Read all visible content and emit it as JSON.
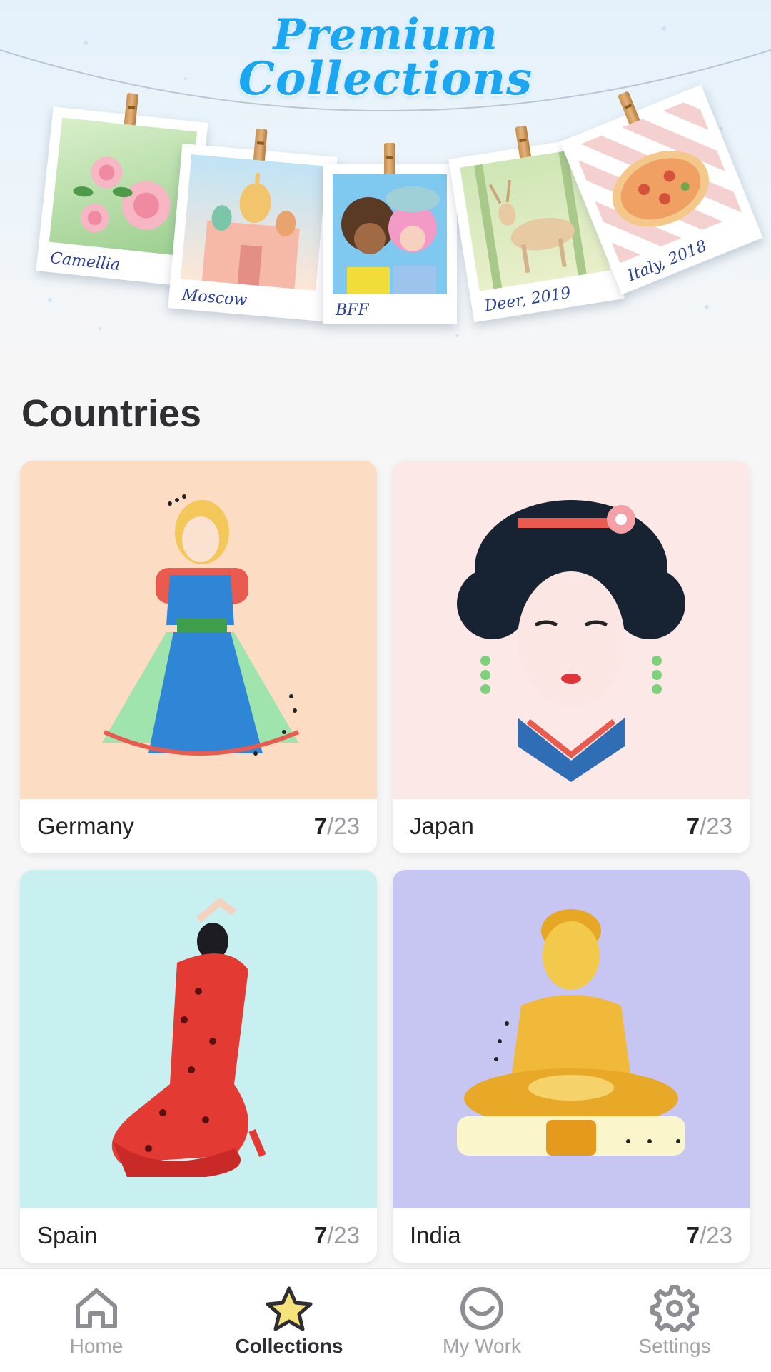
{
  "banner": {
    "title_line1": "Premium",
    "title_line2": "Collections",
    "photos": [
      {
        "caption": "Camellia"
      },
      {
        "caption": "Moscow"
      },
      {
        "caption": "BFF"
      },
      {
        "caption": "Deer, 2019"
      },
      {
        "caption": "Italy, 2018"
      }
    ]
  },
  "section": {
    "title": "Countries"
  },
  "cards": [
    {
      "name": "Germany",
      "done": "7",
      "total": "/23",
      "bg": "#fcdcc3"
    },
    {
      "name": "Japan",
      "done": "7",
      "total": "/23",
      "bg": "#fde8e8"
    },
    {
      "name": "Spain",
      "done": "7",
      "total": "/23",
      "bg": "#c9f0f1"
    },
    {
      "name": "India",
      "done": "7",
      "total": "/23",
      "bg": "#c7c5f2"
    }
  ],
  "nav": {
    "items": [
      {
        "label": "Home",
        "icon": "home-icon"
      },
      {
        "label": "Collections",
        "icon": "star-icon"
      },
      {
        "label": "My Work",
        "icon": "smile-icon"
      },
      {
        "label": "Settings",
        "icon": "gear-icon"
      }
    ],
    "active": "Collections"
  },
  "colors": {
    "accent": "#1aa6f0",
    "star_fill": "#f6e27a"
  }
}
